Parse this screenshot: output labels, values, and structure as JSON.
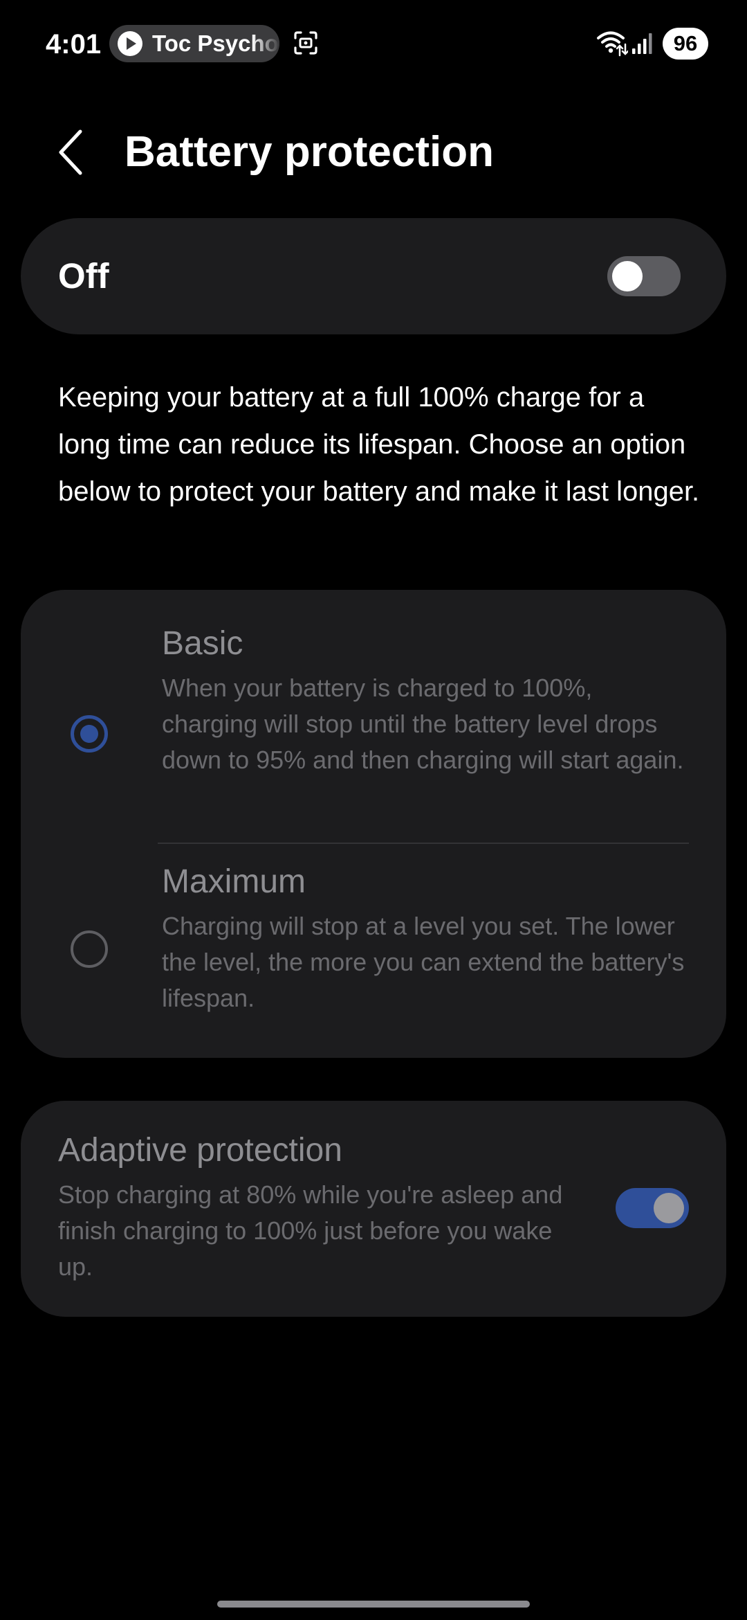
{
  "status_bar": {
    "time": "4:01",
    "media_chip_label": "Toc Psycho",
    "battery_level": "96"
  },
  "header": {
    "title": "Battery protection"
  },
  "master_switch": {
    "label": "Off",
    "enabled": false
  },
  "description": "Keeping your battery at a full 100% charge for a long time can reduce its lifespan. Choose an option below to protect your battery and make it last longer.",
  "options": [
    {
      "title": "Basic",
      "description": "When your battery is charged to 100%, charging will stop until the battery level drops down to 95% and then charging will start again.",
      "selected": true
    },
    {
      "title": "Maximum",
      "description": "Charging will stop at a level you set. The lower the level, the more you can extend the battery's lifespan.",
      "selected": false
    }
  ],
  "adaptive": {
    "title": "Adaptive protection",
    "description": "Stop charging at 80% while you're asleep and finish charging to 100% just before you wake up.",
    "enabled": true
  },
  "icons": {
    "back": "back-arrow-icon",
    "play": "play-icon",
    "screenshot": "screenshot-capture-icon",
    "wifi": "wifi-icon",
    "signal": "signal-icon"
  },
  "colors": {
    "background": "#000000",
    "card": "#1c1c1e",
    "accent": "#2f4f99",
    "disabled_title": "#8e8e92",
    "disabled_text": "#6b6b6f"
  }
}
